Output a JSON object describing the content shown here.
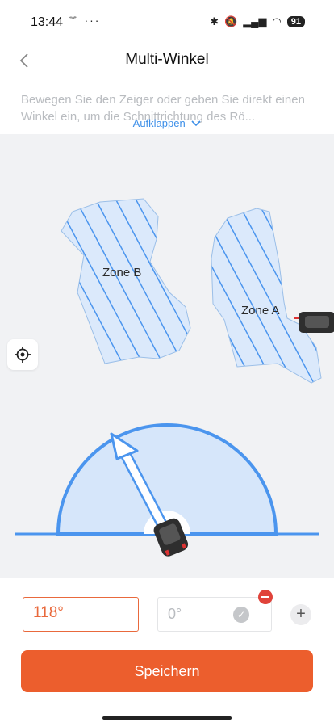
{
  "status_bar": {
    "time": "13:44",
    "left_icons": "⚚ ···",
    "battery": "91"
  },
  "header": {
    "title": "Multi-Winkel",
    "back_icon": "chevron-left-icon"
  },
  "description": {
    "text": "Bewegen Sie den Zeiger oder geben Sie direkt einen Winkel ein, um die Schnittrichtung des Rö...",
    "expand_label": "Aufklappen"
  },
  "map": {
    "zones": [
      {
        "name": "Zone B"
      },
      {
        "name": "Zone A"
      }
    ],
    "angle_degrees": 118
  },
  "angles": {
    "primary_value": "118°",
    "secondary_value": "0°"
  },
  "actions": {
    "save_label": "Speichern",
    "add_label": "+"
  },
  "colors": {
    "accent": "#ec5e2d",
    "link": "#3b8ee8",
    "zone_fill": "#dbe9fb",
    "zone_stripe": "#4b95ee",
    "remove": "#e0433a"
  }
}
